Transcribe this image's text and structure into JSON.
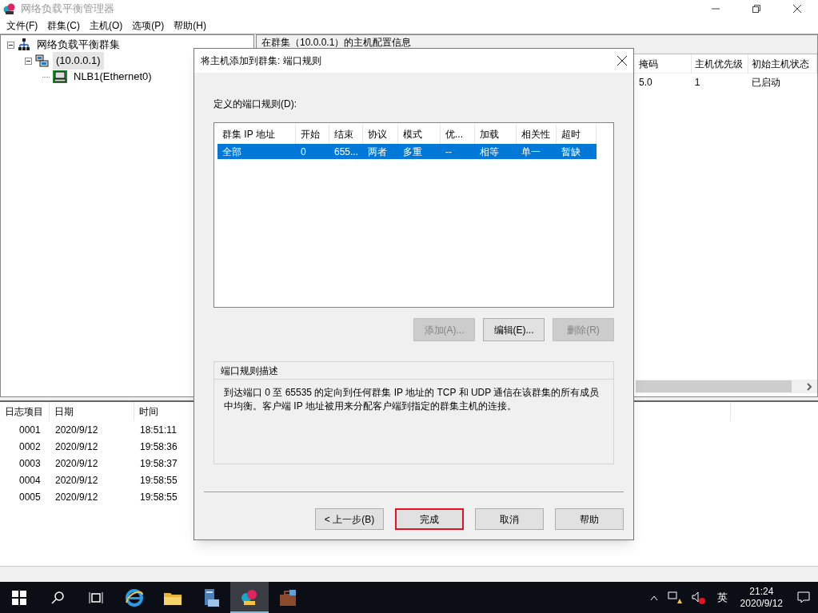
{
  "window": {
    "title": "网络负载平衡管理器"
  },
  "menu": [
    "文件(F)",
    "群集(C)",
    "主机(O)",
    "选项(P)",
    "帮助(H)"
  ],
  "tree": [
    {
      "label": "网络负载平衡群集",
      "kind": "clusters",
      "expanded": true,
      "selected": false,
      "children": [
        {
          "label": "(10.0.0.1)",
          "kind": "cluster",
          "expanded": true,
          "selected": true,
          "children": [
            {
              "label": "NLB1(Ethernet0)",
              "kind": "host",
              "selected": false
            }
          ]
        }
      ]
    }
  ],
  "details": {
    "header": "在群集（10.0.0.1）的主机配置信息",
    "columns": [
      "掩码",
      "主机优先级",
      "初始主机状态"
    ],
    "rows": [
      [
        "5.0",
        "1",
        "已启动"
      ]
    ]
  },
  "log": {
    "columns": [
      "日志项目",
      "日期",
      "时间"
    ],
    "rows": [
      [
        "0001",
        "2020/9/12",
        "18:51:11"
      ],
      [
        "0002",
        "2020/9/12",
        "19:58:36"
      ],
      [
        "0003",
        "2020/9/12",
        "19:58:37"
      ],
      [
        "0004",
        "2020/9/12",
        "19:58:55"
      ],
      [
        "0005",
        "2020/9/12",
        "19:58:55"
      ]
    ]
  },
  "dialog": {
    "title": "将主机添加到群集: 端口规则",
    "rules_label": "定义的端口规则(D):",
    "columns": [
      "群集 IP 地址",
      "开始",
      "结束",
      "协议",
      "模式",
      "优...",
      "加载",
      "相关性",
      "超时"
    ],
    "rows": [
      {
        "cells": [
          "全部",
          "0",
          "655...",
          "两者",
          "多重",
          "--",
          "相等",
          "单一",
          "暂缺"
        ],
        "selected": true
      }
    ],
    "rule_buttons": [
      {
        "label": "添加(A)...",
        "disabled": true
      },
      {
        "label": "编辑(E)...",
        "disabled": false
      },
      {
        "label": "删除(R)",
        "disabled": true
      }
    ],
    "description": {
      "title": "端口规则描述",
      "text": "到达端口 0 至 65535 的定向到任何群集 IP 地址的 TCP 和 UDP 通信在该群集的所有成员中均衡。客户端 IP 地址被用来分配客户端到指定的群集主机的连接。"
    },
    "buttons": [
      {
        "label": "< 上一步(B)",
        "focused": false
      },
      {
        "label": "完成",
        "focused": true
      },
      {
        "label": "取消",
        "focused": false
      },
      {
        "label": "帮助",
        "focused": false
      }
    ]
  },
  "taskbar": {
    "apps": [
      {
        "kind": "start",
        "active": false
      },
      {
        "kind": "search",
        "active": false
      },
      {
        "kind": "taskview",
        "active": false
      },
      {
        "kind": "browser",
        "active": false
      },
      {
        "kind": "folder",
        "active": false
      },
      {
        "kind": "server",
        "active": false
      },
      {
        "kind": "nlb",
        "active": true
      },
      {
        "kind": "toolbox",
        "active": false
      }
    ],
    "ime": "英",
    "time": "21:24",
    "date": "2020/9/12"
  }
}
